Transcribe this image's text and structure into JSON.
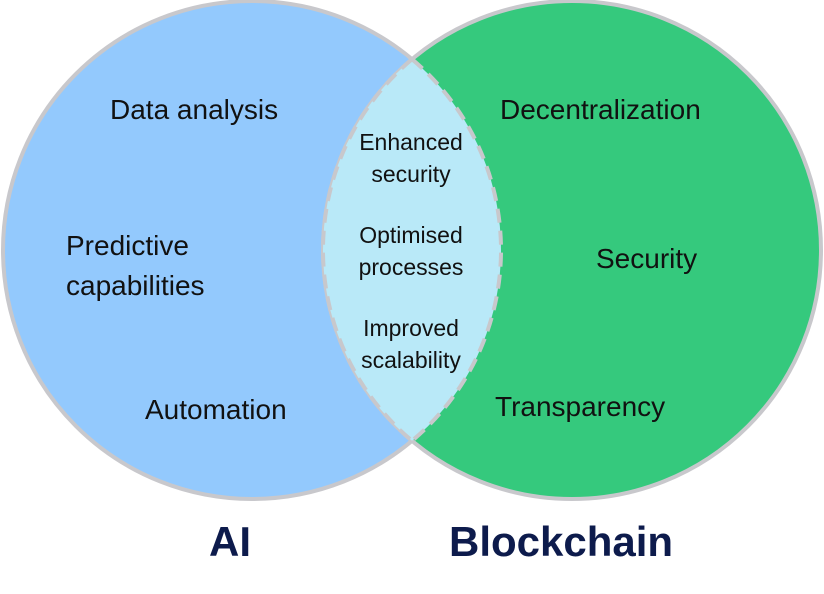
{
  "colors": {
    "ai_fill": "#93c9fd",
    "blockchain_fill": "#35c97d",
    "intersection_fill": "#b9e9f8",
    "outline": "#c8c8cc",
    "title_color": "#0d1b4c"
  },
  "ai": {
    "title": "AI",
    "items": [
      "Data analysis",
      "Predictive\ncapabilities",
      "Automation"
    ]
  },
  "blockchain": {
    "title": "Blockchain",
    "items": [
      "Decentralization",
      "Security",
      "Transparency"
    ]
  },
  "intersection": {
    "items": [
      "Enhanced\nsecurity",
      "Optimised\nprocesses",
      "Improved\nscalability"
    ]
  }
}
